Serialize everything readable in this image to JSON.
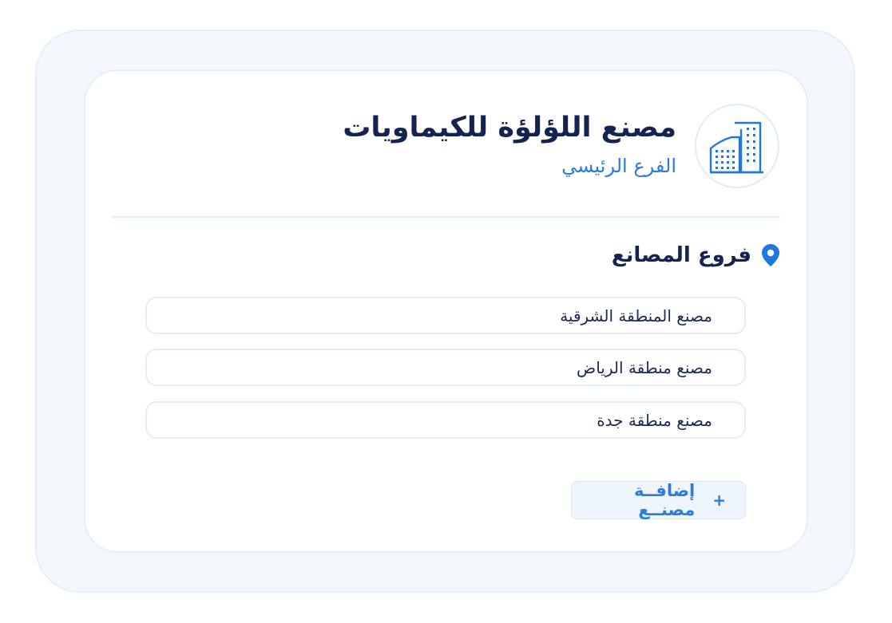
{
  "header": {
    "company_name": "مصنع اللؤلؤة للكيماويات",
    "branch_name": "الفرع الرئيسي"
  },
  "section": {
    "title": "فروع المصانع",
    "icon": "location-pin-icon"
  },
  "branches": [
    {
      "label": "مصنع المنطقة الشرقية"
    },
    {
      "label": "مصنع منطقة الرياض"
    },
    {
      "label": "مصنع منطقة جدة"
    }
  ],
  "actions": {
    "add_label": "إضافــة مصنــع",
    "add_icon": "+"
  },
  "colors": {
    "accent": "#2b7be0",
    "title": "#14234f",
    "border": "#e4edf8",
    "outer_bg": "#f4f8fd"
  }
}
